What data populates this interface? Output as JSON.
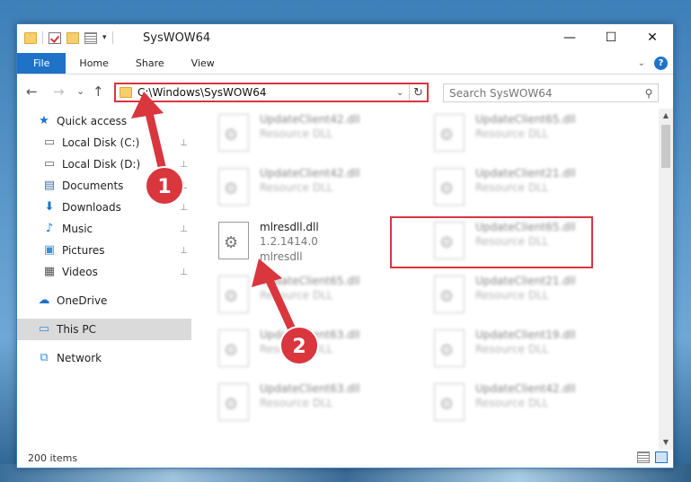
{
  "window": {
    "title": "SysWOW64",
    "controls": {
      "minimize": "—",
      "maximize": "☐",
      "close": "✕"
    }
  },
  "ribbon": {
    "tabs": [
      "File",
      "Home",
      "Share",
      "View"
    ],
    "help": "?"
  },
  "navigation": {
    "back": "←",
    "forward": "→",
    "recent": "⌄",
    "up": "↑",
    "address": "C:\\Windows\\SysWOW64",
    "refresh": "↻",
    "search_placeholder": "Search SysWOW64"
  },
  "sidebar": {
    "items": [
      {
        "label": "Quick access",
        "icon": "star-icon",
        "glyph": "★",
        "color": "#1e73c8"
      },
      {
        "label": "Local Disk (C:)",
        "icon": "drive-icon",
        "glyph": "▭",
        "color": "#666",
        "pinned": true
      },
      {
        "label": "Local Disk (D:)",
        "icon": "drive-icon",
        "glyph": "▭",
        "color": "#666",
        "pinned": true
      },
      {
        "label": "Documents",
        "icon": "document-icon",
        "glyph": "▤",
        "color": "#4a6fa5",
        "pinned": true
      },
      {
        "label": "Downloads",
        "icon": "download-icon",
        "glyph": "⬇",
        "color": "#1e73c8",
        "pinned": true
      },
      {
        "label": "Music",
        "icon": "music-icon",
        "glyph": "♪",
        "color": "#1e73c8",
        "pinned": true
      },
      {
        "label": "Pictures",
        "icon": "pictures-icon",
        "glyph": "▣",
        "color": "#3a8fd6",
        "pinned": true
      },
      {
        "label": "Videos",
        "icon": "video-icon",
        "glyph": "▦",
        "color": "#555",
        "pinned": true
      },
      {
        "label": "OneDrive",
        "icon": "cloud-icon",
        "glyph": "☁",
        "color": "#1e73c8"
      },
      {
        "label": "This PC",
        "icon": "computer-icon",
        "glyph": "▭",
        "color": "#3a8fd6",
        "selected": true
      },
      {
        "label": "Network",
        "icon": "network-icon",
        "glyph": "⧉",
        "color": "#3a8fd6"
      }
    ]
  },
  "files": [
    {
      "name": "UpdateClient42.dll",
      "type": "Resource DLL",
      "blurred": true
    },
    {
      "name": "UpdateClient65.dll",
      "type": "Resource DLL",
      "blurred": true
    },
    {
      "name": "UpdateClient42.dll",
      "type": "Resource DLL",
      "blurred": true
    },
    {
      "name": "UpdateClient21.dll",
      "type": "Resource DLL",
      "blurred": true
    },
    {
      "name": "mlresdll.dll",
      "version": "1.2.1414.0",
      "type": "mlresdll",
      "blurred": false
    },
    {
      "name": "UpdateClient65.dll",
      "type": "Resource DLL",
      "blurred": true
    },
    {
      "name": "UpdateClient65.dll",
      "type": "Resource DLL",
      "blurred": true
    },
    {
      "name": "UpdateClient21.dll",
      "type": "Resource DLL",
      "blurred": true
    },
    {
      "name": "UpdateClient63.dll",
      "type": "Resource DLL",
      "blurred": true
    },
    {
      "name": "UpdateClient19.dll",
      "type": "Resource DLL",
      "blurred": true
    },
    {
      "name": "UpdateClient63.dll",
      "type": "Resource DLL",
      "blurred": true
    },
    {
      "name": "UpdateClient42.dll",
      "type": "Resource DLL",
      "blurred": true
    }
  ],
  "annotations": {
    "step1": "1",
    "step2": "2",
    "color": "#d9363e"
  },
  "status": {
    "item_count": "200 items"
  }
}
